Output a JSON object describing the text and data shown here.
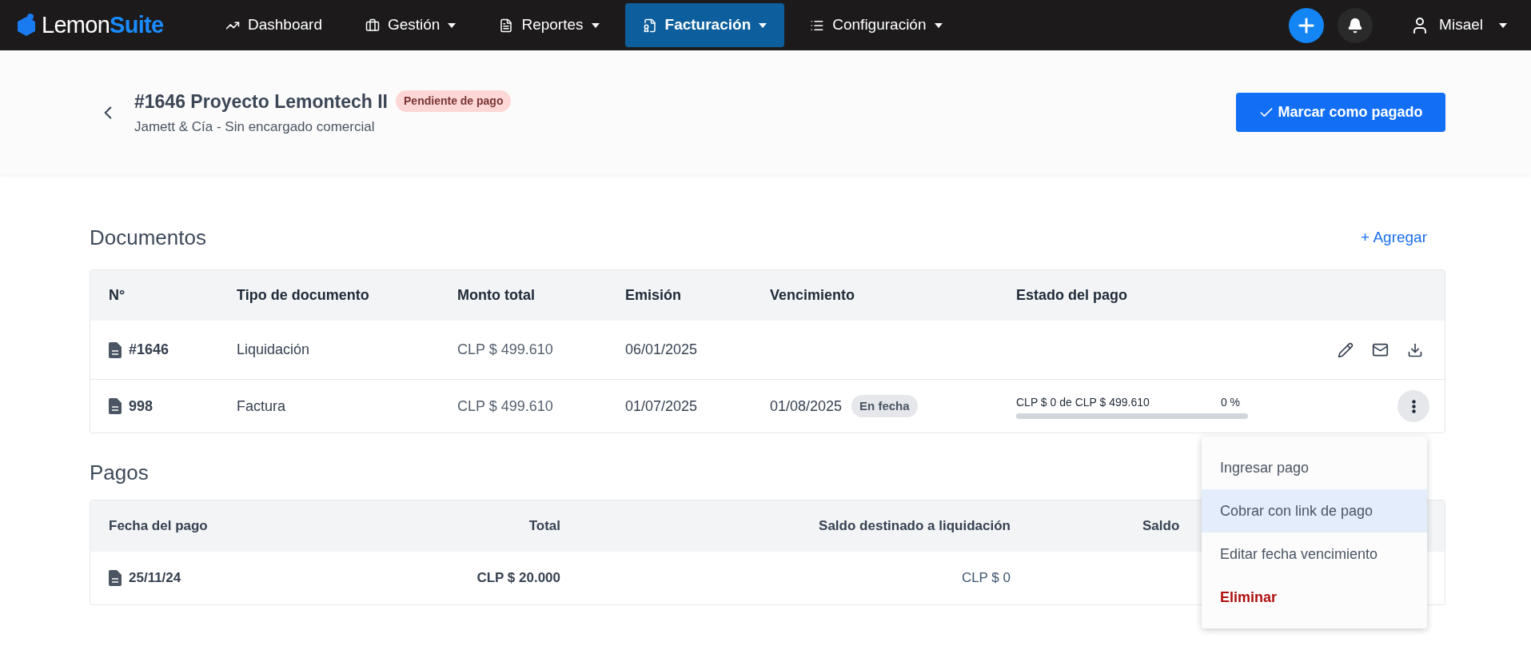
{
  "brand": {
    "part_1": "Lemon",
    "part_2": "Suite"
  },
  "nav": [
    {
      "label": "Dashboard",
      "dropdown": false,
      "selected": false
    },
    {
      "label": "Gestión",
      "dropdown": true,
      "selected": false
    },
    {
      "label": "Reportes",
      "dropdown": true,
      "selected": false
    },
    {
      "label": "Facturación",
      "dropdown": true,
      "selected": true
    },
    {
      "label": "Configuración",
      "dropdown": true,
      "selected": false
    }
  ],
  "user": {
    "name": "Misael"
  },
  "header": {
    "title": "#1646 Proyecto Lemontech II",
    "status": "Pendiente de pago",
    "subtitle": "Jamett & Cía - Sin encargado comercial",
    "primary_button": "Marcar como pagado"
  },
  "documents": {
    "title": "Documentos",
    "add_button": "+ Agregar",
    "columns": [
      "N°",
      "Tipo de documento",
      "Monto total",
      "Emisión",
      "Vencimiento",
      "Estado del pago"
    ],
    "rows": [
      {
        "kind": "actions",
        "number": "#1646",
        "type": "Liquidación",
        "amount": "CLP $ 499.610",
        "issued": "06/01/2025"
      },
      {
        "kind": "menu",
        "number": "998",
        "type": "Factura",
        "amount": "CLP $ 499.610",
        "issued": "01/07/2025",
        "due": "01/08/2025",
        "due_badge": "En fecha",
        "payment_text": "CLP $ 0 de CLP $ 499.610",
        "payment_percent": "0 %",
        "level": 0
      }
    ]
  },
  "payments": {
    "title": "Pagos",
    "columns": [
      "Fecha del pago",
      "Total",
      "Saldo destinado a liquidación",
      "Saldo"
    ],
    "rows": [
      {
        "date": "25/11/24",
        "total": "CLP $ 20.000",
        "allocated": "CLP $ 0"
      }
    ]
  },
  "menu": [
    {
      "label": "Ingresar pago",
      "kind": "normal",
      "selected": false
    },
    {
      "label": "Cobrar con link de pago",
      "kind": "normal",
      "selected": true
    },
    {
      "label": "Editar fecha vencimiento",
      "kind": "normal",
      "selected": false
    },
    {
      "label": "Eliminar",
      "kind": "danger",
      "selected": false
    }
  ]
}
